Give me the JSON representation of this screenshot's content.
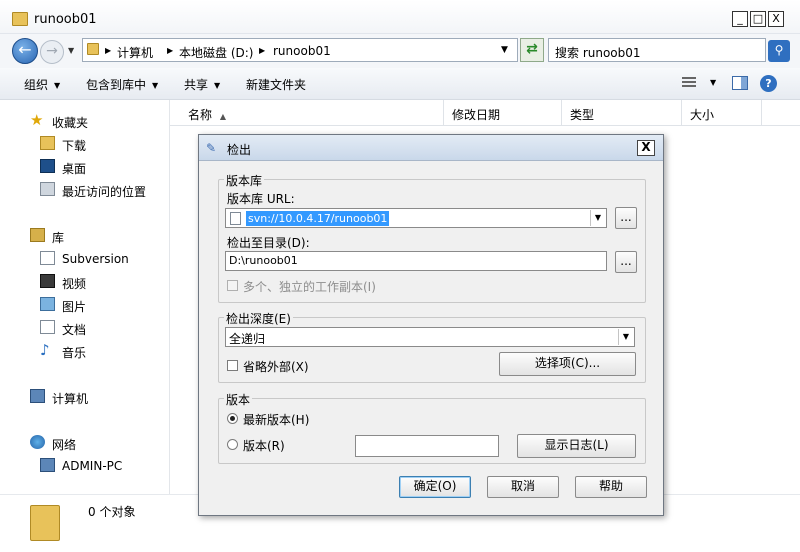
{
  "window": {
    "title": "runoob01",
    "minimize_label": "_",
    "maximize_label": "□",
    "close_label": "X"
  },
  "nav": {
    "back_label": "←",
    "forward_label": "→",
    "breadcrumbs": [
      "计算机",
      "本地磁盘 (D:)",
      "runoob01"
    ],
    "search_placeholder": "搜索 runoob01"
  },
  "toolbar": {
    "organize": "组织",
    "include_in_library": "包含到库中",
    "share": "共享",
    "new_folder": "新建文件夹"
  },
  "sidebar": {
    "favorites": "收藏夹",
    "downloads": "下载",
    "desktop": "桌面",
    "recent": "最近访问的位置",
    "libraries": "库",
    "subversion": "Subversion",
    "videos": "视频",
    "pictures": "图片",
    "documents": "文档",
    "music": "音乐",
    "computer": "计算机",
    "network": "网络",
    "admin_pc": "ADMIN-PC"
  },
  "columns": {
    "name": "名称",
    "date_modified": "修改日期",
    "type": "类型",
    "size": "大小"
  },
  "status": {
    "count": "0 个对象"
  },
  "dialog": {
    "title": "检出",
    "close_label": "X",
    "repository_group": "版本库",
    "repo_url_label": "版本库 URL:",
    "repo_url_value": "svn://10.0.4.17/runoob01",
    "checkout_dir_label": "检出至目录(D):",
    "checkout_dir_value": "D:\\runoob01",
    "browse_label": "...",
    "multiple_copies_label": "多个、独立的工作副本(I)",
    "depth_label": "检出深度(E)",
    "depth_value": "全递归",
    "omit_externals_label": "省略外部(X)",
    "choose_items_label": "选择项(C)...",
    "revision_group": "版本",
    "head_revision_label": "最新版本(H)",
    "revision_label": "版本(R)",
    "revision_value": "",
    "show_log_label": "显示日志(L)",
    "ok_label": "确定(O)",
    "cancel_label": "取消",
    "help_label": "帮助"
  },
  "colors": {
    "selection": "#3399ff",
    "accent": "#2f6fc0"
  }
}
